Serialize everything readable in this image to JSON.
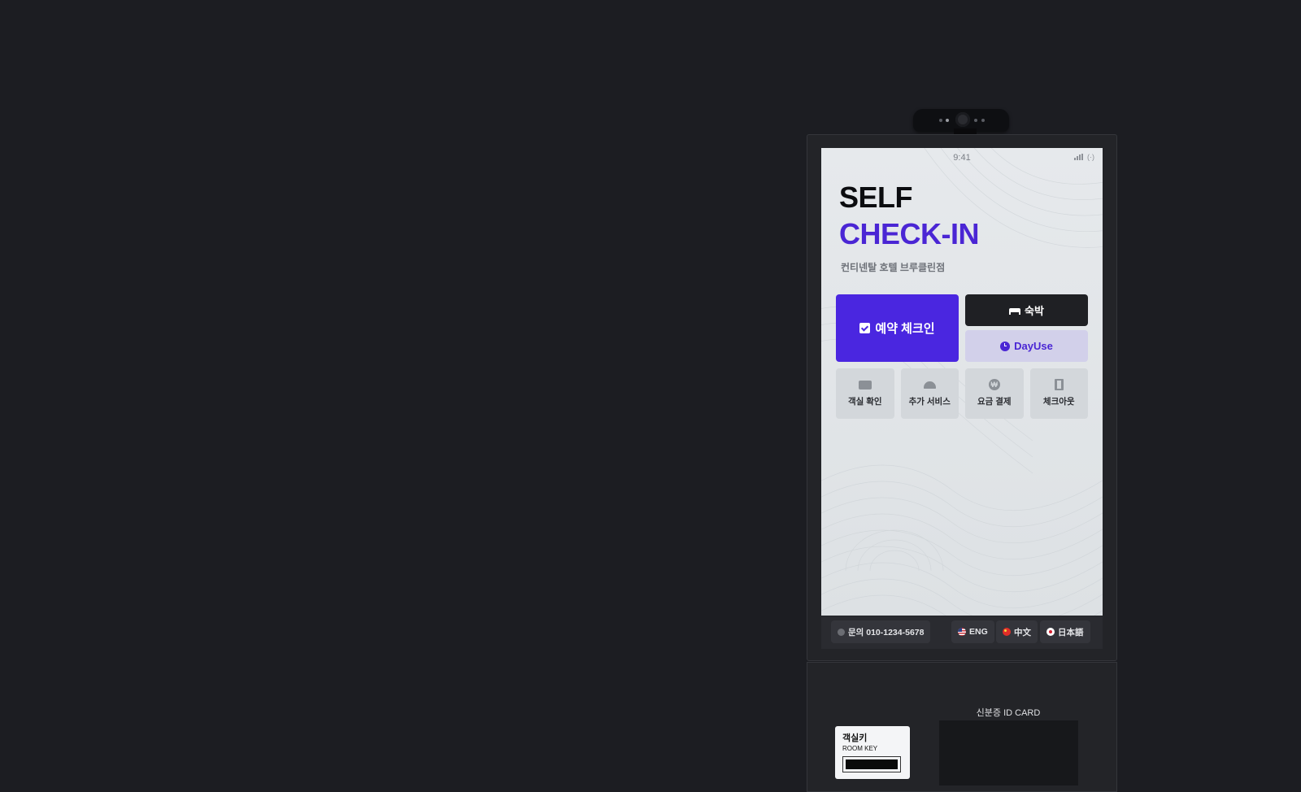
{
  "status": {
    "time": "9:41",
    "signal_icon": "signal-icon",
    "wifi_icon": "wifi-icon"
  },
  "hero": {
    "line1": "SELF",
    "line2": "CHECK-IN",
    "hotel": "컨티넨탈 호텔 브루클린점"
  },
  "actions": {
    "primary": {
      "label": "예약 체크인",
      "icon": "checkbox-icon"
    },
    "stay": {
      "label": "숙박",
      "icon": "bed-icon"
    },
    "dayuse": {
      "label": "DayUse",
      "icon": "clock-icon"
    }
  },
  "tiles": [
    {
      "label": "객실 확인",
      "icon": "card-icon"
    },
    {
      "label": "추가 서비스",
      "icon": "bell-icon"
    },
    {
      "label": "요금 결제",
      "icon": "won-icon",
      "glyph": "₩"
    },
    {
      "label": "체크아웃",
      "icon": "door-icon"
    }
  ],
  "footer": {
    "contact": "문의 010-1234-5678",
    "languages": [
      "ENG",
      "中文",
      "日本語"
    ]
  },
  "hardware": {
    "id_card_label": "신분증 ID CARD",
    "room_key_ko": "객실키",
    "room_key_en": "ROOM KEY"
  },
  "colors": {
    "accent": "#4a26e0",
    "accent_text": "#4a26d4",
    "dayuse_bg": "#d2d0ea",
    "stay_bg": "#1f2024",
    "background": "#1c1d22"
  }
}
